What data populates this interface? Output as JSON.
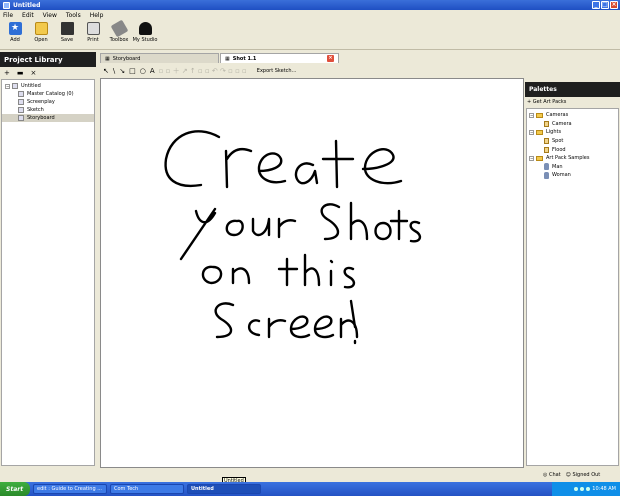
{
  "window": {
    "title": "Untitled",
    "buttons": [
      "_",
      "□",
      "×"
    ]
  },
  "menu": [
    "File",
    "Edit",
    "View",
    "Tools",
    "Help"
  ],
  "toolbar": [
    {
      "label": "Add",
      "icon": "add-icon"
    },
    {
      "label": "Open",
      "icon": "folder-icon"
    },
    {
      "label": "Save",
      "icon": "save-icon"
    },
    {
      "label": "Print",
      "icon": "print-icon"
    },
    {
      "label": "Toolbox",
      "icon": "toolbox-icon"
    },
    {
      "label": "My Studio",
      "icon": "studio-icon"
    }
  ],
  "project_library": {
    "title": "Project Library",
    "tools": [
      "+",
      "▬",
      "×"
    ],
    "items": [
      {
        "label": "Untitled",
        "level": 0,
        "toggle": "−"
      },
      {
        "label": "Master Catalog (0)",
        "level": 1
      },
      {
        "label": "Screenplay",
        "level": 1
      },
      {
        "label": "Sketch",
        "level": 1
      },
      {
        "label": "Storyboard",
        "level": 1,
        "selected": true
      }
    ]
  },
  "tabs": [
    {
      "label": "Storyboard",
      "active": false
    },
    {
      "label": "Shot 1.1",
      "active": true
    }
  ],
  "sketch_toolbar": {
    "tools": [
      "↖",
      "\\",
      "↘",
      "□",
      "○",
      "A"
    ],
    "export_label": "Export Sketch..."
  },
  "canvas": {
    "handwriting_lines": [
      "Create",
      "your Shots",
      "on this",
      "Screen!"
    ]
  },
  "palettes": {
    "title": "Palettes",
    "get_art_label": "Get Art Packs",
    "items": [
      {
        "label": "Cameras",
        "level": 0,
        "kind": "folder"
      },
      {
        "label": "Camera",
        "level": 1,
        "kind": "leaf"
      },
      {
        "label": "Lights",
        "level": 0,
        "kind": "folder"
      },
      {
        "label": "Spot",
        "level": 1,
        "kind": "leaf"
      },
      {
        "label": "Flood",
        "level": 1,
        "kind": "leaf"
      },
      {
        "label": "Art Pack Samples",
        "level": 0,
        "kind": "folder"
      },
      {
        "label": "Man",
        "level": 1,
        "kind": "person"
      },
      {
        "label": "Woman",
        "level": 1,
        "kind": "person"
      }
    ]
  },
  "status": {
    "chat": "Chat",
    "signed_out": "Signed Out"
  },
  "taskbar": {
    "start": "Start",
    "tasks": [
      {
        "label": "edit : Guide to Creating ...",
        "active": false
      },
      {
        "label": "Com Tech",
        "active": false
      },
      {
        "label": "Untitled",
        "active": true
      }
    ],
    "tooltip": "Untitled",
    "clock": "10:48 AM"
  }
}
